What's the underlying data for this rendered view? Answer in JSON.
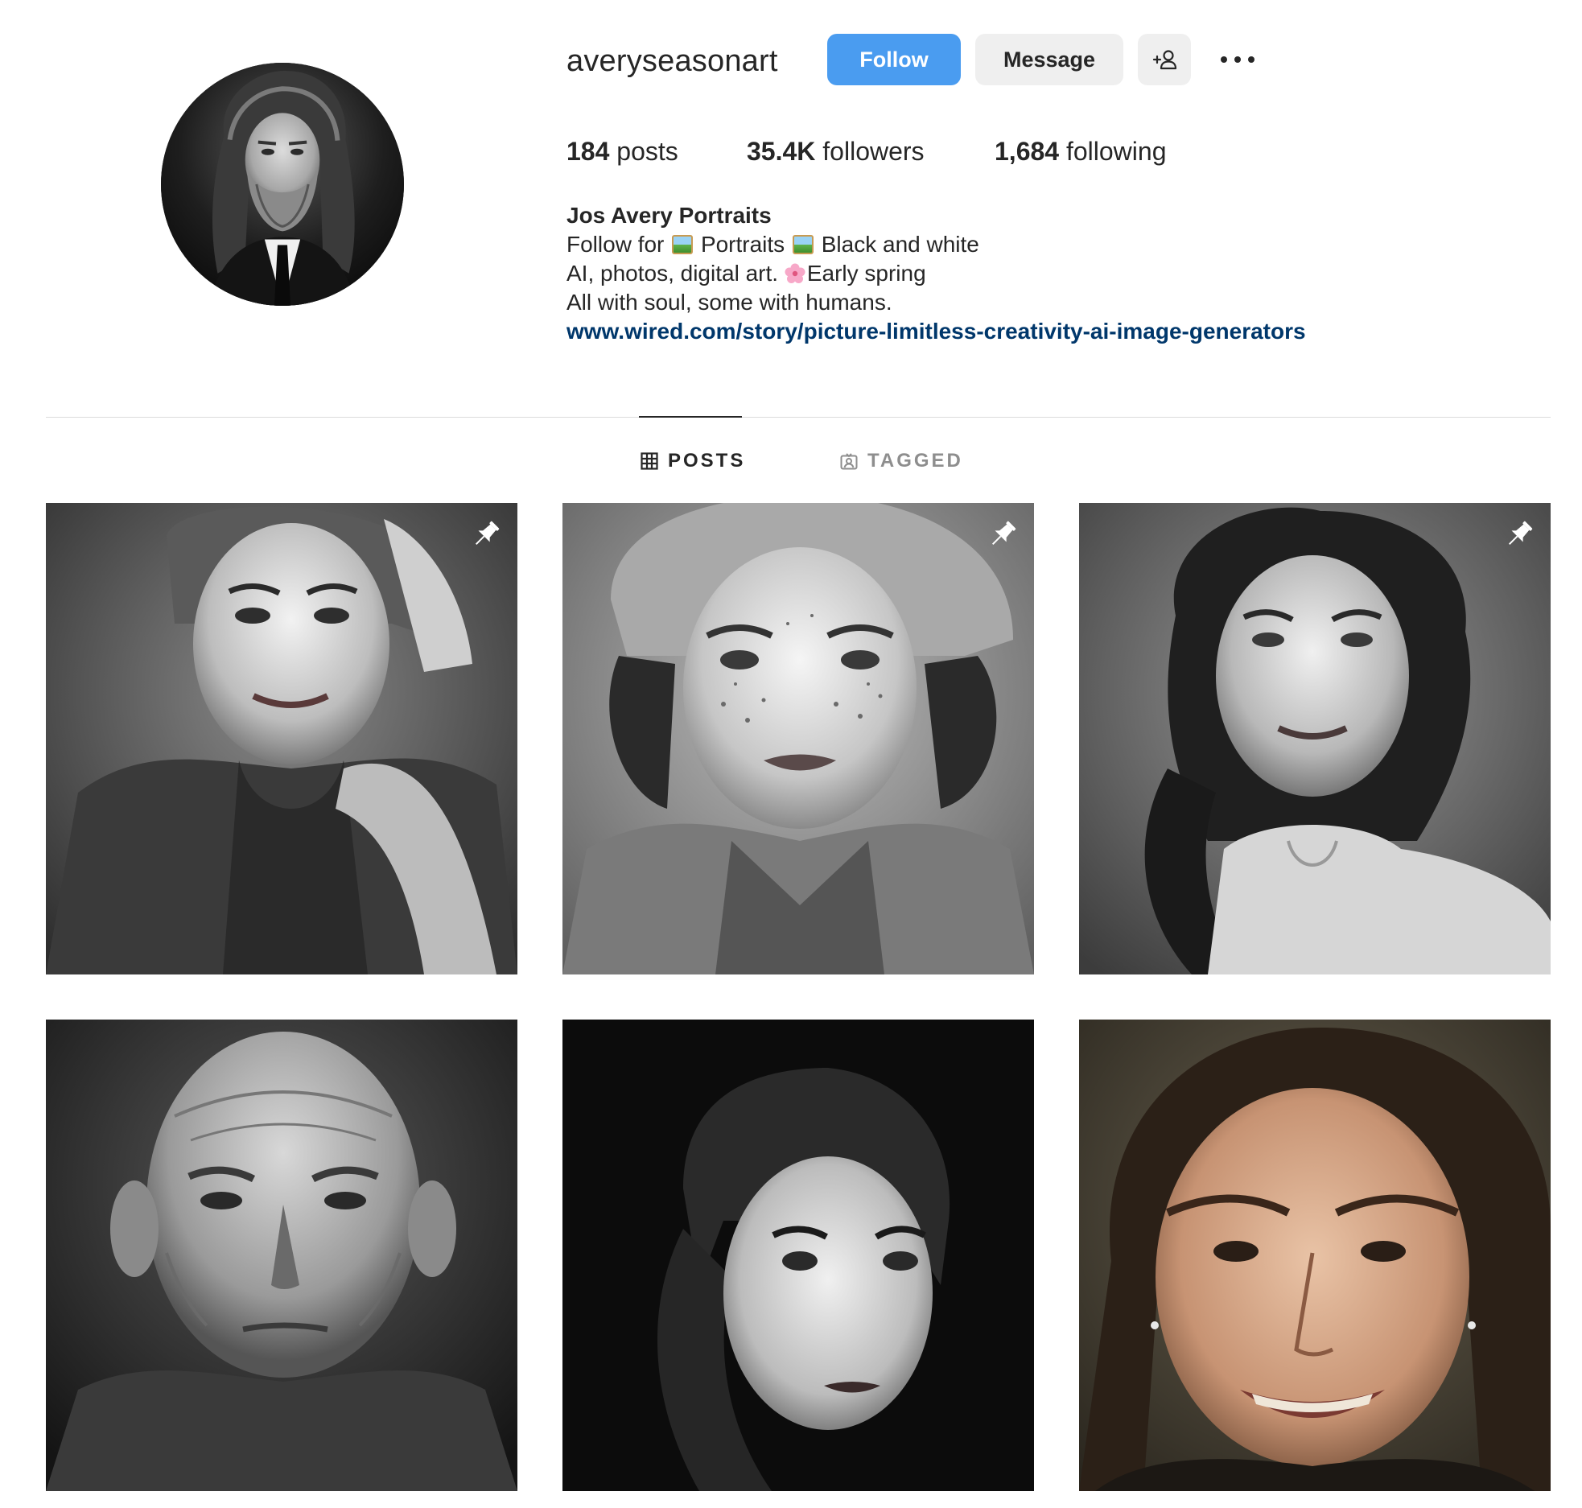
{
  "profile": {
    "username": "averyseasonart",
    "avatar_icon": "bearded-man-portrait"
  },
  "actions": {
    "follow_label": "Follow",
    "message_label": "Message",
    "add_user_icon": "person-add-icon",
    "more_icon": "more-options-icon"
  },
  "stats": {
    "posts_count": "184",
    "posts_label": "posts",
    "followers_count": "35.4K",
    "followers_label": "followers",
    "following_count": "1,684",
    "following_label": "following"
  },
  "bio": {
    "name": "Jos Avery Portraits",
    "line1_a": "Follow for",
    "line1_b": "Portraits",
    "line1_c": "Black and white",
    "line2_a": "AI, photos, digital art.",
    "line2_b": "Early spring",
    "line3": "All with soul, some with humans.",
    "link": "www.wired.com/story/picture-limitless-creativity-ai-image-generators"
  },
  "tabs": [
    {
      "label": "POSTS",
      "icon": "grid-icon",
      "active": true
    },
    {
      "label": "TAGGED",
      "icon": "tagged-icon",
      "active": false
    }
  ],
  "posts": [
    {
      "subject": "woman-with-knit-cap-and-scarf",
      "pinned": true,
      "tone": "black-and-white"
    },
    {
      "subject": "freckled-woman-with-cap",
      "pinned": true,
      "tone": "black-and-white"
    },
    {
      "subject": "woman-with-wavy-hair",
      "pinned": true,
      "tone": "black-and-white"
    },
    {
      "subject": "elderly-bald-man",
      "pinned": false,
      "tone": "black-and-white"
    },
    {
      "subject": "woman-with-dark-curls",
      "pinned": false,
      "tone": "black-and-white"
    },
    {
      "subject": "smiling-woman",
      "pinned": false,
      "tone": "color"
    }
  ],
  "colors": {
    "follow_button": "#4a9cf0",
    "secondary_button": "#efefef",
    "link": "#00376b",
    "divider": "#dbdbdb",
    "muted_text": "#8e8e8e"
  }
}
